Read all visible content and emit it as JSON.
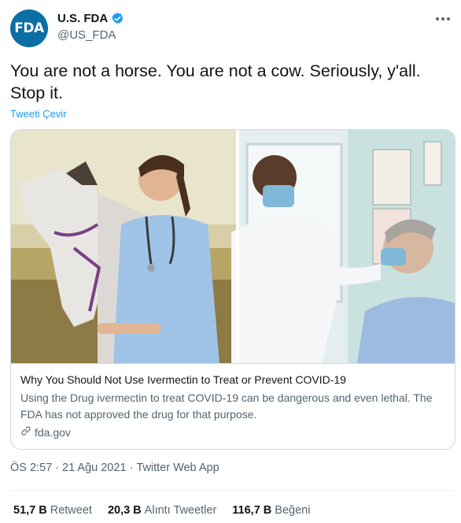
{
  "author": {
    "avatar_text": "FDA",
    "display_name": "U.S. FDA",
    "handle": "@US_FDA",
    "verified": true
  },
  "tweet": {
    "text": "You are not a horse. You are not a cow. Seriously, y'all. Stop it.",
    "translate_label": "Tweeti Çevir"
  },
  "card": {
    "title": "Why You Should Not Use Ivermectin to Treat or Prevent COVID-19",
    "description": "Using the Drug ivermectin to treat COVID-19 can be dangerous and even lethal. The FDA has not approved the drug for that purpose.",
    "domain": "fda.gov"
  },
  "meta": {
    "time": "ÖS 2:57",
    "date": "21 Ağu 2021",
    "separator": "·",
    "source": "Twitter Web App"
  },
  "stats": [
    {
      "count": "51,7 B",
      "label": "Retweet"
    },
    {
      "count": "20,3 B",
      "label": "Alıntı Tweetler"
    },
    {
      "count": "116,7 B",
      "label": "Beğeni"
    }
  ],
  "colors": {
    "accent": "#1d9bf0",
    "brand": "#0b6fa4",
    "secondary_text": "#536471",
    "border": "#cfd9de"
  }
}
